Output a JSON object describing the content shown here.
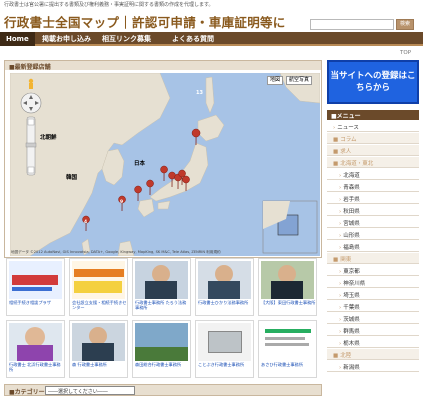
{
  "tagline": "行政書士は官公署に提出する書類及び権利義務・事実証明に関する書類の作成を代理します。",
  "logo": "行政書士全国マップ｜許認可申請・車庫証明等に",
  "search": {
    "placeholder": "",
    "button": "検索"
  },
  "nav": [
    "Home",
    "掲載お申し込み",
    "相互リンク募集",
    "よくある質問"
  ],
  "top_link": "TOP",
  "map_panel": {
    "title": "■最新登録店舗",
    "btn_map": "地図",
    "btn_satellite": "航空写真",
    "label_kitachosen": "北朝鮮",
    "label_kankoku": "韓国",
    "label_nihon": "日本",
    "attribution": "地図データ ©2012 AutoNavi, GIS Innovatsia, DATA+, Google, Kingway, MapKing, SK M&C, Tele Atlas, ZENRIN  利用規約",
    "marker_top": "13",
    "marker_cluster_a": "9",
    "marker_cluster_b": "4"
  },
  "thumbs": [
    {
      "caption": "相続手続き相談プラザ"
    },
    {
      "caption": "会社設立支援・相続手続きセンター"
    },
    {
      "caption": "行政書士事務所 たろう法務事務所"
    },
    {
      "caption": "行政書士ひかり法務事務所"
    },
    {
      "caption": "【大阪】東田行政書士事務所"
    },
    {
      "caption": "行政書士 北浜行政書士事務所"
    },
    {
      "caption": "森 行政書士事務所"
    },
    {
      "caption": "森田総合行政書士事務所"
    },
    {
      "caption": "ことぶき行政書士事務所"
    },
    {
      "caption": "あさひ行政書士事務所"
    }
  ],
  "category": {
    "label": "■カテゴリー",
    "selected": "――選択してください――"
  },
  "sidebar": {
    "cta": "当サイトへの登録はこちらから",
    "menu_head": "■メニュー",
    "items": [
      {
        "label": "ニュース",
        "type": "item"
      },
      {
        "label": "コラム",
        "type": "section"
      },
      {
        "label": "求人",
        "type": "section"
      },
      {
        "label": "北海道・東北",
        "type": "section"
      },
      {
        "label": "北海道",
        "type": "sub"
      },
      {
        "label": "青森県",
        "type": "sub"
      },
      {
        "label": "岩手県",
        "type": "sub"
      },
      {
        "label": "秋田県",
        "type": "sub"
      },
      {
        "label": "宮城県",
        "type": "sub"
      },
      {
        "label": "山形県",
        "type": "sub"
      },
      {
        "label": "福島県",
        "type": "sub"
      },
      {
        "label": "関東",
        "type": "section"
      },
      {
        "label": "東京都",
        "type": "sub"
      },
      {
        "label": "神奈川県",
        "type": "sub"
      },
      {
        "label": "埼玉県",
        "type": "sub"
      },
      {
        "label": "千葉県",
        "type": "sub"
      },
      {
        "label": "茨城県",
        "type": "sub"
      },
      {
        "label": "群馬県",
        "type": "sub"
      },
      {
        "label": "栃木県",
        "type": "sub"
      },
      {
        "label": "北陸",
        "type": "section"
      },
      {
        "label": "新潟県",
        "type": "sub"
      }
    ]
  },
  "colors": {
    "brand": "#6b4a2a",
    "cta": "#1f63e0",
    "marker": "#c0392b"
  }
}
